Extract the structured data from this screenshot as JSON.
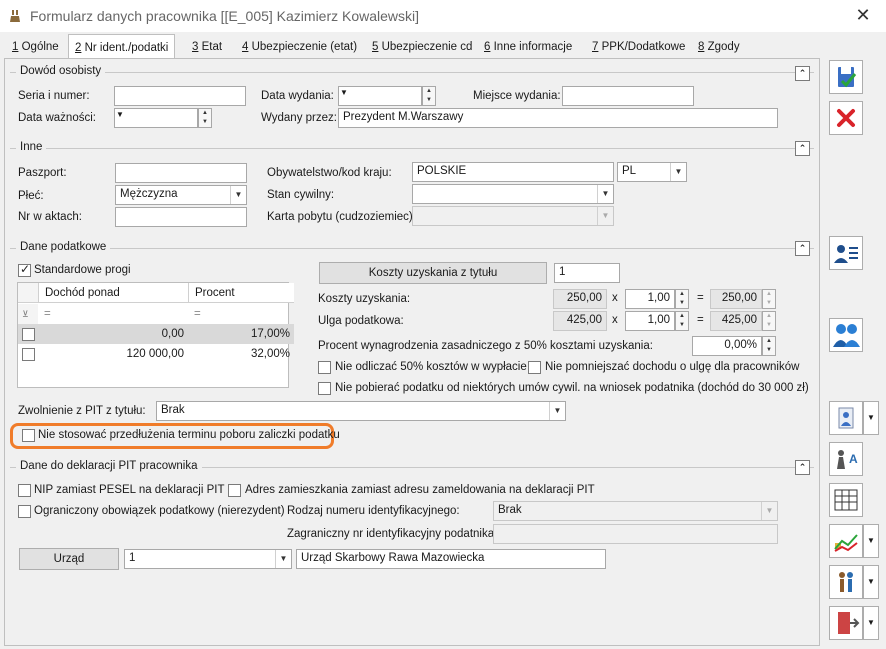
{
  "window": {
    "title": "Formularz danych pracownika [[E_005] Kazimierz Kowalewski]"
  },
  "tabs": [
    {
      "key": "1",
      "label": " Ogólne"
    },
    {
      "key": "2",
      "label": " Nr ident./podatki"
    },
    {
      "key": "3",
      "label": " Etat"
    },
    {
      "key": "4",
      "label": " Ubezpieczenie (etat)"
    },
    {
      "key": "5",
      "label": " Ubezpieczenie cd"
    },
    {
      "key": "6",
      "label": " Inne informacje"
    },
    {
      "key": "7",
      "label": " PPK/Dodatkowe"
    },
    {
      "key": "8",
      "label": " Zgody"
    }
  ],
  "dowod": {
    "title": "Dowód osobisty",
    "seria_label": "Seria i numer:",
    "seria_value": "",
    "data_wydania_label": "Data wydania:",
    "data_wydania_value": "",
    "miejsce_label": "Miejsce wydania:",
    "miejsce_value": "",
    "data_waznosci_label": "Data ważności:",
    "data_waznosci_value": "",
    "wydany_label": "Wydany przez:",
    "wydany_value": "Prezydent M.Warszawy"
  },
  "inne": {
    "title": "Inne",
    "paszport_label": "Paszport:",
    "paszport_value": "",
    "obyw_label": "Obywatelstwo/kod kraju:",
    "obyw_value": "POLSKIE",
    "kod_value": "PL",
    "plec_label": "Płeć:",
    "plec_value": "Mężczyzna",
    "stan_label": "Stan cywilny:",
    "stan_value": "",
    "akta_label": "Nr w aktach:",
    "akta_value": "",
    "karta_label": "Karta pobytu (cudzoziemiec):",
    "karta_value": ""
  },
  "podatkowe": {
    "title": "Dane podatkowe",
    "standardowe_label": "Standardowe progi",
    "standardowe_checked": true,
    "grid": {
      "col1": "Dochód ponad",
      "col2": "Procent",
      "filter": "=",
      "rows": [
        {
          "dochod": "0,00",
          "procent": "17,00%"
        },
        {
          "dochod": "120 000,00",
          "procent": "32,00%"
        }
      ]
    },
    "koszty_button": "Koszty uzyskania z tytułu",
    "koszty_tytul_value": "1",
    "koszty_label": "Koszty uzyskania:",
    "koszty_value": "250,00",
    "koszty_mult": "1,00",
    "koszty_result": "250,00",
    "ulga_label": "Ulga podatkowa:",
    "ulga_value": "425,00",
    "ulga_mult": "1,00",
    "ulga_result": "425,00",
    "x_sign": "x",
    "eq_sign": "=",
    "procent_label": "Procent wynagrodzenia zasadniczego z 50% kosztami uzyskania:",
    "procent_value": "0,00%",
    "nie_odliczac_label": "Nie odliczać 50% kosztów w wypłacie",
    "nie_pomniejszac_label": "Nie pomniejszać dochodu o ulgę dla pracowników",
    "nie_pobierac_label": "Nie pobierać podatku od niektórych umów cywil. na wniosek podatnika (dochód do 30 000 zł)",
    "zwolnienie_label": "Zwolnienie z PIT z tytułu:",
    "zwolnienie_value": "Brak",
    "nie_stosowac_label": "Nie stosować przedłużenia terminu poboru zaliczki podatku"
  },
  "pit": {
    "title": "Dane do deklaracji PIT pracownika",
    "nip_label": "NIP zamiast PESEL na deklaracji PIT",
    "adres_label": "Adres zamieszkania zamiast adresu zameldowania na deklaracji PIT",
    "ograniczony_label": "Ograniczony obowiązek podatkowy (nierezydent)",
    "rodzaj_label": "Rodzaj numeru identyfikacyjnego:",
    "rodzaj_value": "Brak",
    "zagraniczny_label": "Zagraniczny nr identyfikacyjny podatnika:",
    "zagraniczny_value": "",
    "urzad_button": "Urząd",
    "urzad_code": "1",
    "urzad_name": "Urząd Skarbowy Rawa Mazowiecka"
  },
  "colors": {
    "highlight": "#f07c2a",
    "cancel": "#d9232a",
    "accent": "#2b6cb0"
  }
}
